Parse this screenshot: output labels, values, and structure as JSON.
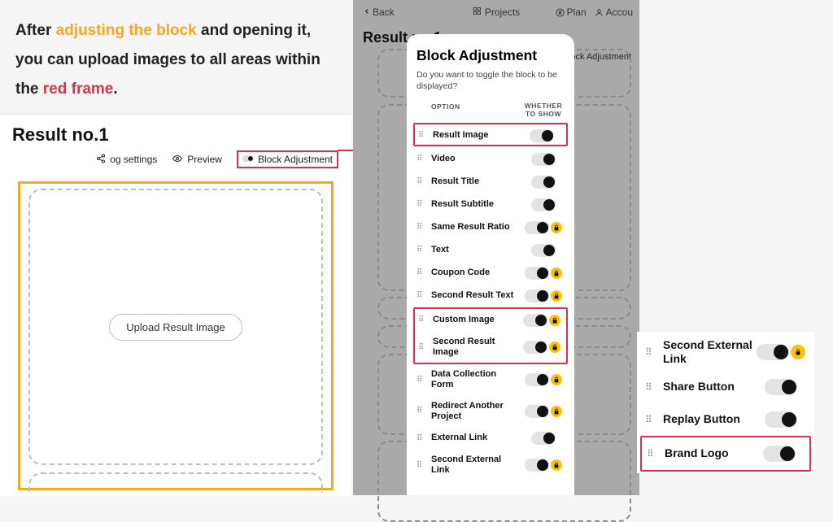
{
  "instruction": {
    "prefix": "After ",
    "highlight1": "adjusting the block",
    "mid1": " and opening it, you can upload images to all areas within the ",
    "highlight2": "red frame",
    "suffix": "."
  },
  "editor": {
    "title": "Result no.1",
    "toolbar": {
      "og_settings": "og settings",
      "preview": "Preview",
      "block_adjustment": "Block Adjustment"
    },
    "upload_button": "Upload Result Image"
  },
  "phone": {
    "back": "Back",
    "projects": "Projects",
    "plan": "Plan",
    "account": "Accou",
    "result_title": "Result no.1",
    "badge": "Block Adjustment"
  },
  "modal": {
    "title": "Block Adjustment",
    "subtitle": "Do you want to toggle the block to be displayed?",
    "col_option": "OPTION",
    "col_show": "WHETHER TO SHOW",
    "options": [
      {
        "label": "Result Image",
        "on": true,
        "lock": false,
        "red_group": 1
      },
      {
        "label": "Video",
        "on": true,
        "lock": false
      },
      {
        "label": "Result Title",
        "on": true,
        "lock": false
      },
      {
        "label": "Result Subtitle",
        "on": true,
        "lock": false
      },
      {
        "label": "Same Result Ratio",
        "on": true,
        "lock": true
      },
      {
        "label": "Text",
        "on": true,
        "lock": false
      },
      {
        "label": "Coupon Code",
        "on": true,
        "lock": true
      },
      {
        "label": "Second Result Text",
        "on": true,
        "lock": true
      },
      {
        "label": "Custom Image",
        "on": true,
        "lock": true,
        "red_group": 2
      },
      {
        "label": "Second Result Image",
        "on": true,
        "lock": true,
        "red_group": 2
      },
      {
        "label": "Data Collection Form",
        "on": true,
        "lock": true
      },
      {
        "label": "Redirect Another Project",
        "on": true,
        "lock": true
      },
      {
        "label": "External Link",
        "on": true,
        "lock": false
      },
      {
        "label": "Second External Link",
        "on": true,
        "lock": true
      }
    ]
  },
  "float_list": {
    "items": [
      {
        "label": "Second External Link",
        "on": true,
        "lock": true
      },
      {
        "label": "Share Button",
        "on": true,
        "lock": false
      },
      {
        "label": "Replay Button",
        "on": true,
        "lock": false
      },
      {
        "label": "Brand Logo",
        "on": true,
        "lock": false,
        "red_group": 3
      }
    ]
  }
}
